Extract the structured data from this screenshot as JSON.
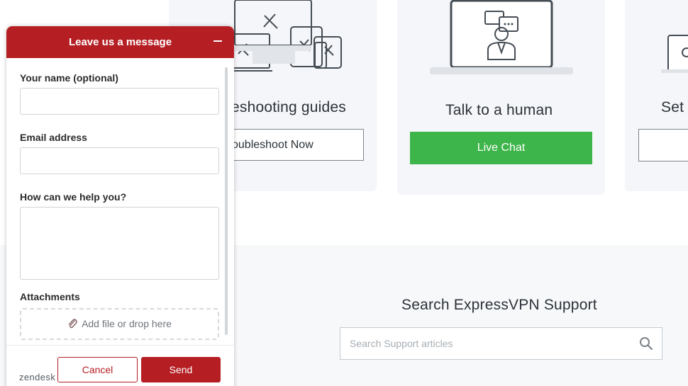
{
  "cards": [
    {
      "title": "eshooting guides",
      "button": "oubleshoot Now"
    },
    {
      "title": "Talk to a human",
      "button": "Live Chat"
    },
    {
      "title": "Set",
      "button": ""
    }
  ],
  "search": {
    "title": "Search ExpressVPN Support",
    "placeholder": "Search Support articles"
  },
  "widget": {
    "title": "Leave us a message",
    "fields": {
      "name_label": "Your name (optional)",
      "email_label": "Email address",
      "help_label": "How can we help you?",
      "attachments_label": "Attachments",
      "attach_text": "Add file or drop here"
    },
    "cancel_label": "Cancel",
    "send_label": "Send",
    "brand": "zendesk"
  },
  "colors": {
    "widget_accent": "#b51f24",
    "live_chat_green": "#3eb54a",
    "card_bg": "#f5f6f9"
  }
}
